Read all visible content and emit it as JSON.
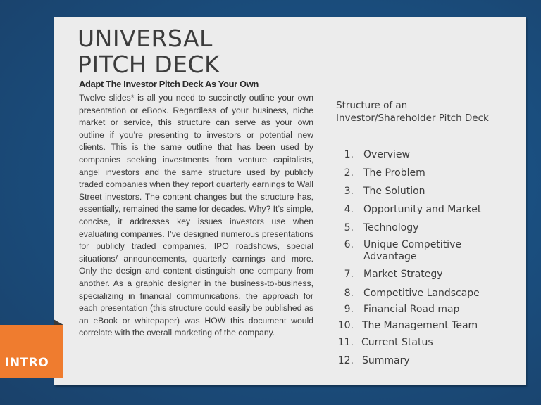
{
  "slide": {
    "title_lines": [
      "UNIVERSAL",
      "PITCH DECK"
    ],
    "subtitle": "Adapt The Investor Pitch Deck As Your Own",
    "body": "Twelve slides* is all you need to succinctly outline your own presentation or eBook. Regardless of your business, niche market or service, this structure can serve as your own outline if you’re presenting to investors or potential new clients. This is the same outline that has been used by companies seeking investments from venture capitalists, angel investors and the same structure used by publicly traded companies when they report quarterly earnings to Wall Street investors. The content changes but the structure has, essentially, remained the same for decades. Why? It’s simple, concise, it addresses key issues investors use when evaluating companies. I’ve designed numerous presentations for publicly traded companies, IPO roadshows, special situations/ announcements, quarterly earnings and more. Only the design and content distinguish one company from another. As a graphic designer in the business-to-business, specializing in financial communications, the approach for each presentation (this structure could easily be published as an eBook or whitepaper) was HOW this document would correlate with the overall marketing of the company.",
    "toc_heading": "Structure of an Investor/Shareholder Pitch Deck",
    "toc": [
      {
        "num": "1.",
        "label": "Overview"
      },
      {
        "num": "2.",
        "label": "The Problem"
      },
      {
        "num": "3.",
        "label": "The Solution"
      },
      {
        "num": "4.",
        "label": "Opportunity and Market"
      },
      {
        "num": "5.",
        "label": "Technology"
      },
      {
        "num": "6.",
        "label": "Unique Competitive Advantage"
      },
      {
        "num": "7.",
        "label": "Market Strategy"
      },
      {
        "num": "8.",
        "label": "Competitive Landscape"
      },
      {
        "num": "9.",
        "label": "Financial Road map"
      },
      {
        "num": "10.",
        "label": "The Management Team"
      },
      {
        "num": "11.",
        "label": "Current Status"
      },
      {
        "num": "12.",
        "label": "Summary"
      }
    ],
    "tab_label": "INTRO",
    "colors": {
      "background": "#1a4f80",
      "card": "#ececec",
      "accent": "#ef7c2f",
      "text": "#3c3c3c"
    }
  }
}
